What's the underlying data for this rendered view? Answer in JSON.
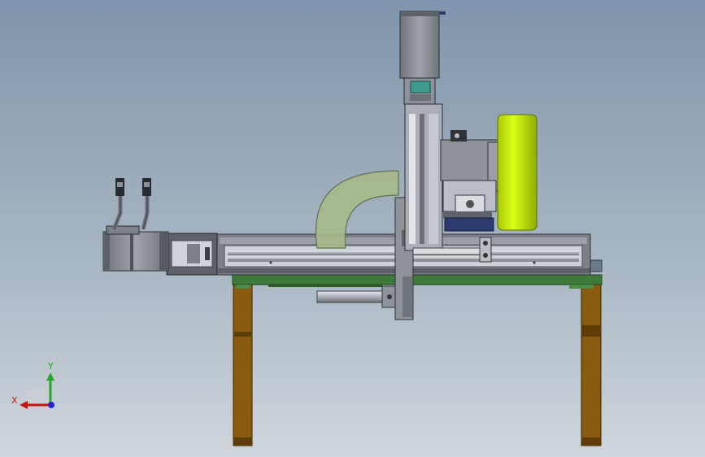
{
  "view": {
    "type": "cad-assembly-front-view",
    "background": {
      "top": "#7f95ab",
      "mid": "#a7b5c2",
      "bottom": "#cfd6dc"
    }
  },
  "triad": {
    "x_label": "X",
    "y_label": "Y",
    "x_color": "#cc1111",
    "y_color": "#22aa22",
    "z_color": "#2222dd"
  },
  "colors": {
    "steel_dark": "#555b63",
    "steel_mid": "#8d9399",
    "steel_light": "#b9bfc5",
    "frame_green": "#3f7a3a",
    "leg_brown": "#8a5a0e",
    "leg_dark": "#5e3c06",
    "wheel_yellow": "#c8f000",
    "hose_green": "#a7b98a",
    "teal": "#3e9b8f",
    "navy": "#2d3a6e"
  }
}
